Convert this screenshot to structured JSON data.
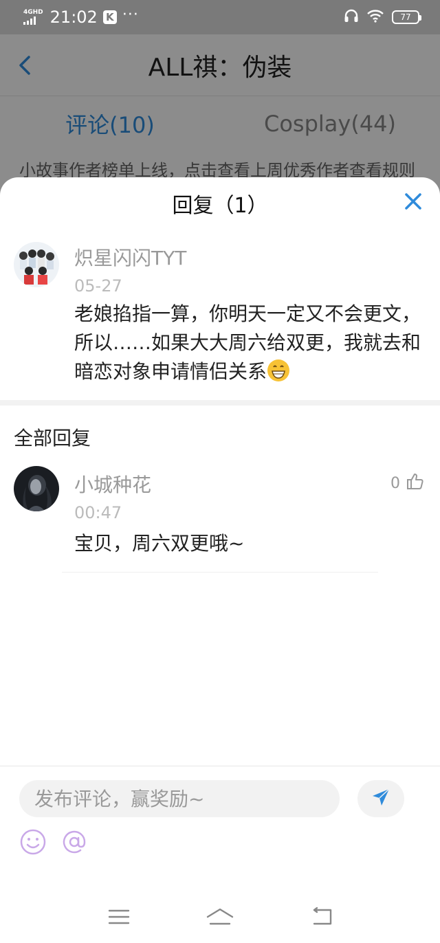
{
  "status_bar": {
    "network": "4GHD",
    "time": "21:02",
    "app_badge": "K",
    "more": "···",
    "battery": "77"
  },
  "background_page": {
    "title": "ALL祺：伪装",
    "tabs": [
      {
        "label": "评论(10)",
        "active": true
      },
      {
        "label": "Cosplay(44)",
        "active": false
      }
    ],
    "notice": "小故事作者榜单上线，点击查看上周优秀作者查看规则"
  },
  "sheet": {
    "title": "回复（1）",
    "main_comment": {
      "username": "炽星闪闪TYT",
      "date": "05-27",
      "text": "老娘掐指一算，你明天一定又不会更文，所以……如果大大周六给双更，我就去和暗恋对象申请情侣关系"
    },
    "all_replies_label": "全部回复",
    "replies": [
      {
        "username": "小城种花",
        "time": "00:47",
        "text": "宝贝，周六双更哦~",
        "likes": "0"
      }
    ]
  },
  "composer": {
    "placeholder": "发布评论，赢奖励~"
  },
  "colors": {
    "accent": "#2f8bdb",
    "icon_purple": "#c9a8e8"
  }
}
